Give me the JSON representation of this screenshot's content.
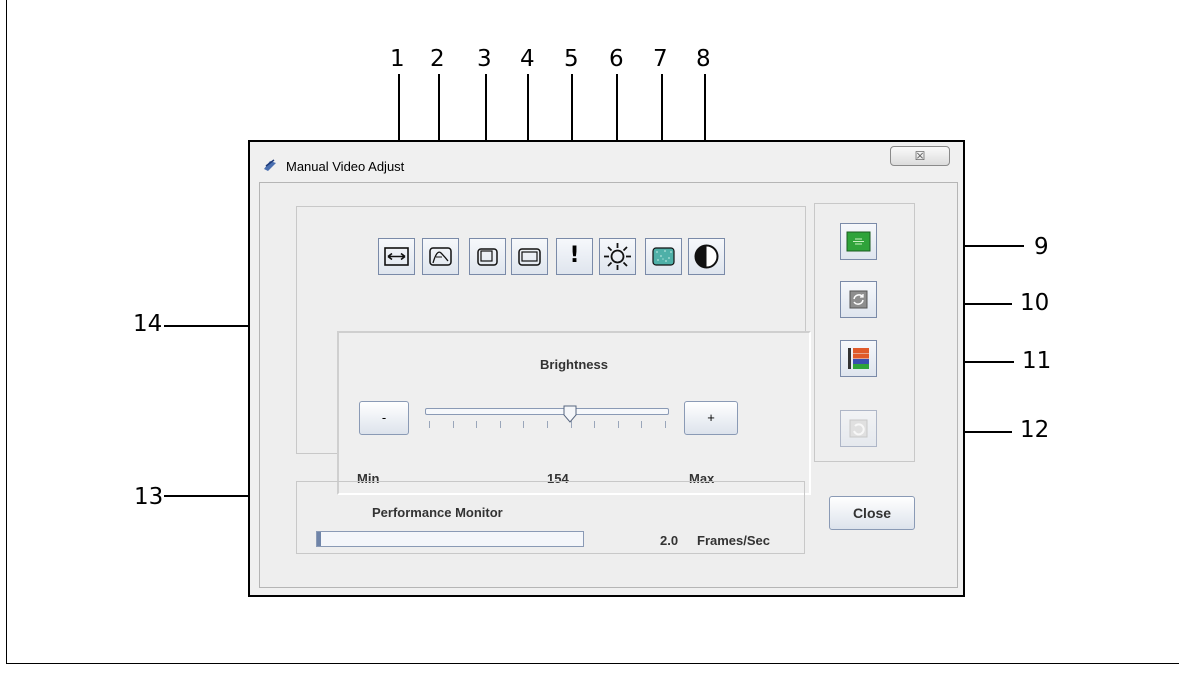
{
  "window": {
    "title": "Manual Video Adjust",
    "close_glyph": "☒"
  },
  "callouts": {
    "n1": "1",
    "n2": "2",
    "n3": "3",
    "n4": "4",
    "n5": "5",
    "n6": "6",
    "n7": "7",
    "n8": "8",
    "n9": "9",
    "n10": "10",
    "n11": "11",
    "n12": "12",
    "n13": "13",
    "n14": "14"
  },
  "toolbar": {
    "icons": [
      "horizontal-size-icon",
      "auto-adjust-icon",
      "window-small-icon",
      "window-large-icon",
      "alert-icon",
      "brightness-sun-icon",
      "noise-icon",
      "contrast-icon"
    ],
    "alert_glyph": "!"
  },
  "side_buttons": {
    "icons": [
      "color-mode-icon",
      "refresh-icon",
      "color-bars-icon",
      "undo-icon"
    ],
    "color_mode_color": "#2fa33a",
    "undo_enabled": false
  },
  "slider": {
    "title": "Brightness",
    "minus_label": "-",
    "plus_label": "+",
    "min_label": "Min",
    "max_label": "Max",
    "value_text": "154",
    "value_fraction": 0.6
  },
  "performance": {
    "title": "Performance Monitor",
    "value": "2.0",
    "unit": "Frames/Sec"
  },
  "actions": {
    "close_label": "Close"
  },
  "colors": {
    "accent_green": "#2fa33a",
    "window_bg": "#f0f0f0",
    "button_border": "#8a9ab5"
  }
}
